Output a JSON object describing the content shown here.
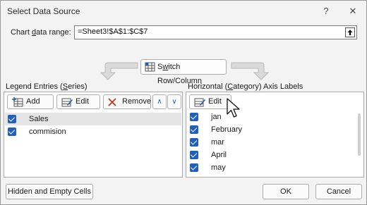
{
  "window": {
    "title": "Select Data Source",
    "help_glyph": "?",
    "close_glyph": "✕"
  },
  "range": {
    "label_prefix": "Chart ",
    "label_underlined": "d",
    "label_suffix": "ata range:",
    "value": "=Sheet3!$A$1:$C$7"
  },
  "switch_button": {
    "label_prefix": "S",
    "label_underlined": "w",
    "label_suffix": "itch Row/Column"
  },
  "legend": {
    "title_prefix": "Legend Entries (",
    "title_underlined": "S",
    "title_suffix": "eries)",
    "add_label": "Add",
    "edit_label": "Edit",
    "remove_label": "Remove",
    "up_glyph": "∧",
    "down_glyph": "∨",
    "items": [
      {
        "label": "Sales",
        "checked": true
      },
      {
        "label": "commision",
        "checked": true
      }
    ]
  },
  "axis": {
    "title_prefix": "Horizontal (",
    "title_underlined": "C",
    "title_suffix": "ategory) Axis Labels",
    "edit_label": "Edit",
    "items": [
      {
        "label": "jan",
        "checked": true
      },
      {
        "label": "February",
        "checked": true
      },
      {
        "label": "mar",
        "checked": true
      },
      {
        "label": "April",
        "checked": true
      },
      {
        "label": "may",
        "checked": true
      }
    ]
  },
  "footer": {
    "hidden_empty_label": "Hidden and Empty Cells",
    "ok_label": "OK",
    "cancel_label": "Cancel"
  },
  "colors": {
    "accent": "#1f5fbf",
    "remove_red": "#c42b1c",
    "selected_row": "#e5e5e5"
  }
}
